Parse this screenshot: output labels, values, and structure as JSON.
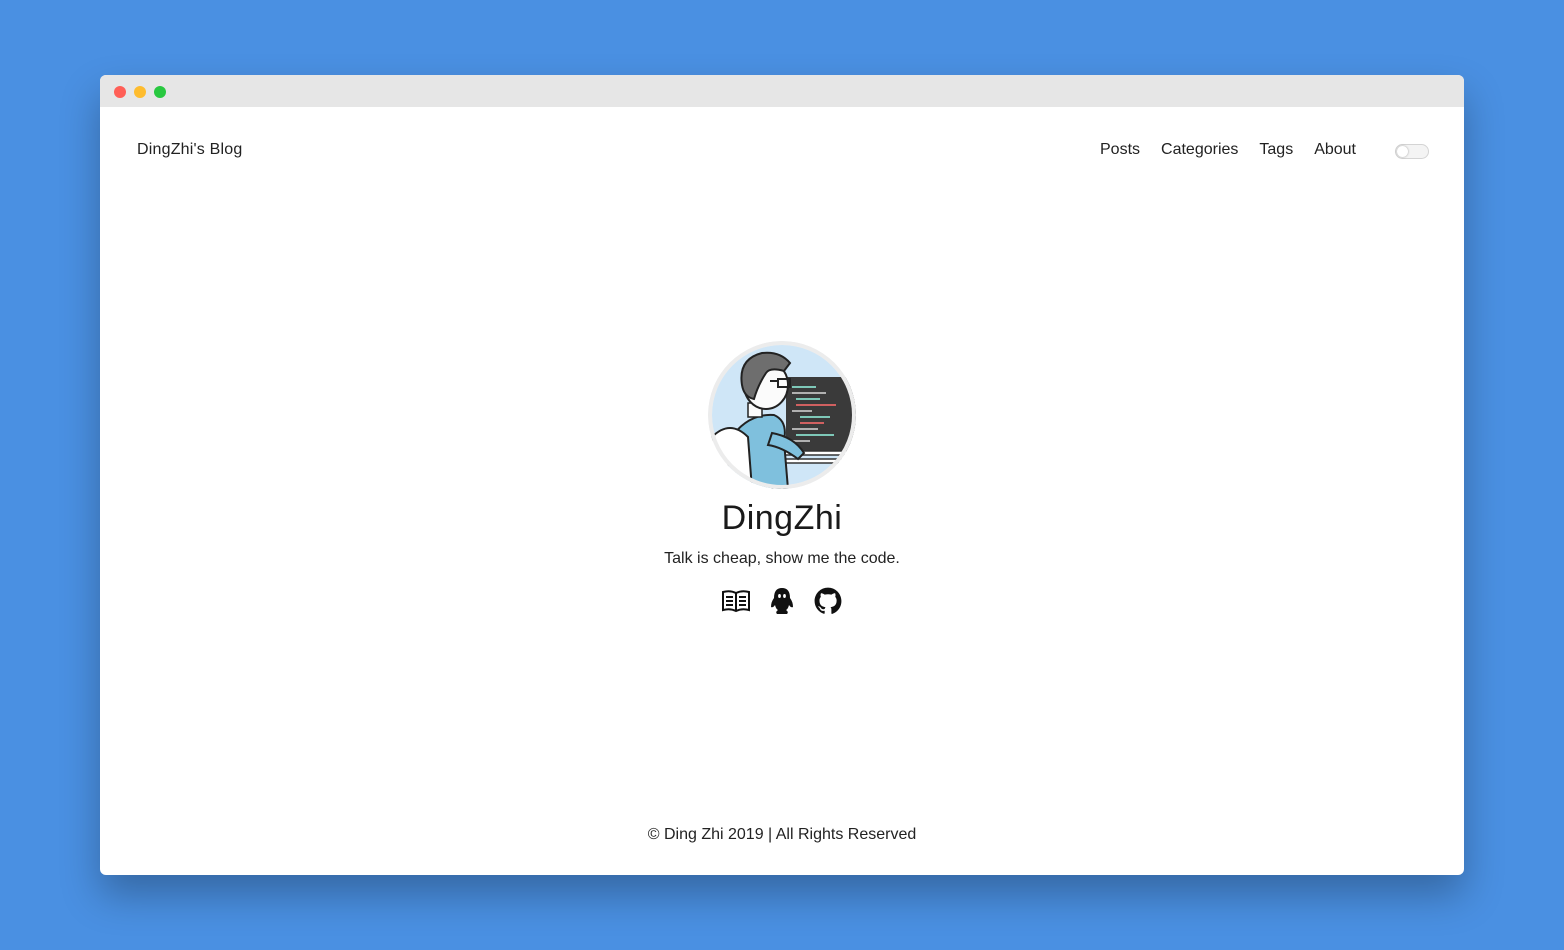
{
  "browser": {
    "traffic_lights": [
      "close",
      "minimize",
      "maximize"
    ]
  },
  "navbar": {
    "brand": "DingZhi's Blog",
    "menu": [
      {
        "label": "Posts"
      },
      {
        "label": "Categories"
      },
      {
        "label": "Tags"
      },
      {
        "label": "About"
      }
    ],
    "theme_toggle": {
      "state": "off"
    }
  },
  "profile": {
    "name": "DingZhi",
    "subtitle": "Talk is cheap, show me the code.",
    "social": [
      {
        "icon": "book-icon"
      },
      {
        "icon": "qq-icon"
      },
      {
        "icon": "github-icon"
      }
    ]
  },
  "footer": {
    "copyright": "© Ding Zhi 2019 | All Rights Reserved"
  },
  "colors": {
    "background": "#4a90e2",
    "window": "#ffffff",
    "titlebar": "#e6e6e6",
    "close": "#ff5f57",
    "minimize": "#febc2e",
    "maximize": "#28c840",
    "text": "#222222"
  }
}
